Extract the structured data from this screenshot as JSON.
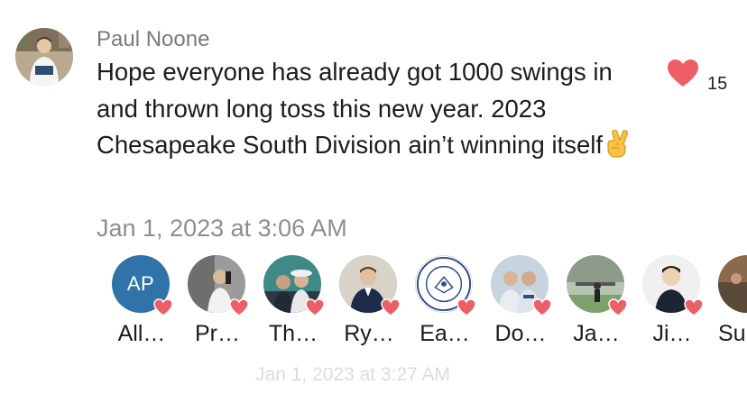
{
  "message": {
    "author": "Paul Noone",
    "text": "Hope everyone has already got 1000 swings in and thrown long toss this new year. 2023 Chesapeake South Division ain’t winning itself",
    "emoji": "crossed-fingers-emoji",
    "timestamp": "Jan 1, 2023 at 3:06 AM",
    "likes": {
      "icon": "heart-icon",
      "count": "15",
      "color": "#ec5f67"
    }
  },
  "reactors": [
    {
      "initials": "AP",
      "name": "All…"
    },
    {
      "name": "Pr…"
    },
    {
      "name": "Th…"
    },
    {
      "name": "Ry…"
    },
    {
      "name": "Ea…"
    },
    {
      "name": "Do…"
    },
    {
      "name": "Ja…"
    },
    {
      "name": "Ji…"
    },
    {
      "name": "Su"
    }
  ],
  "next_message": {
    "timestamp": "Jan 1, 2023 at 3:27 AM"
  }
}
